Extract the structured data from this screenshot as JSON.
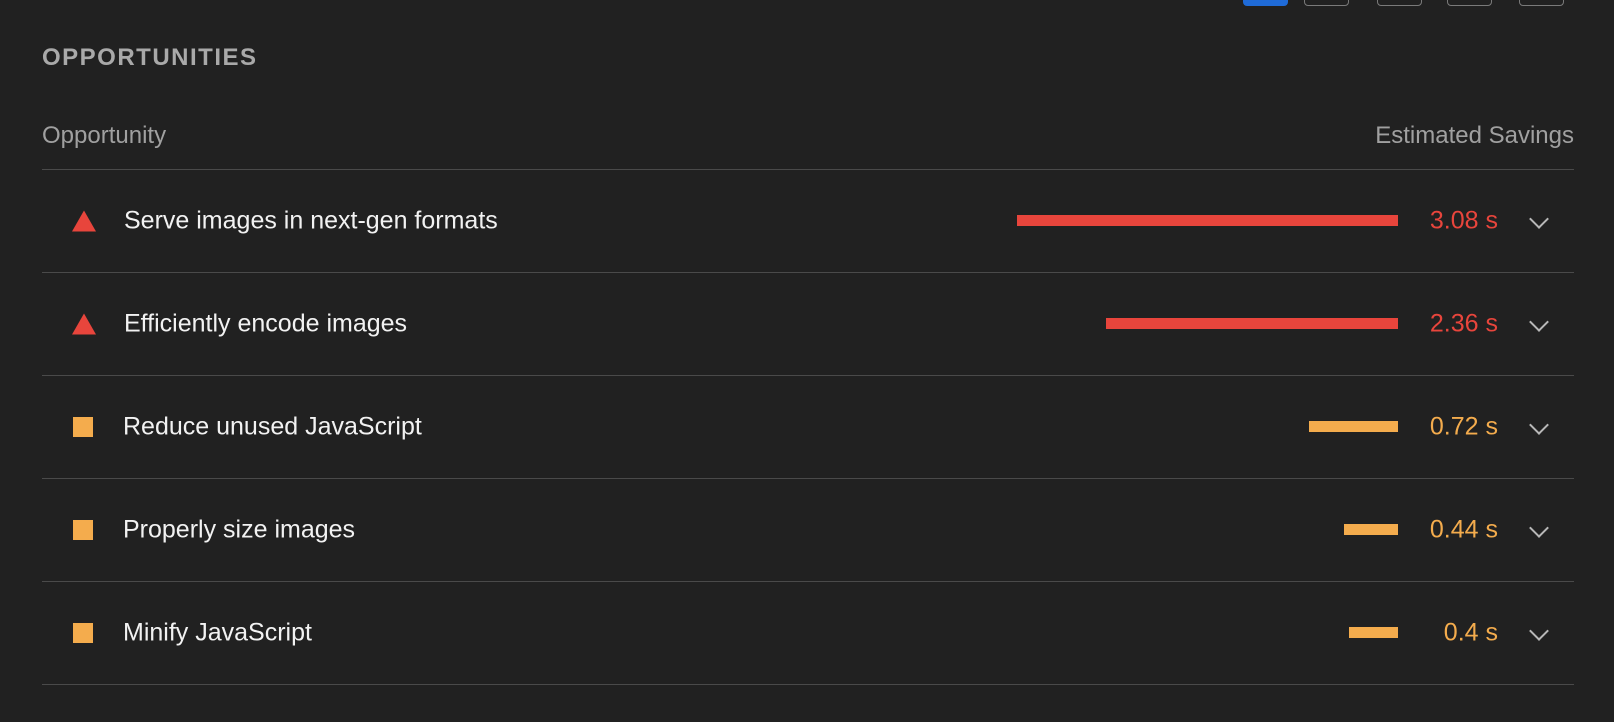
{
  "section": {
    "title": "OPPORTUNITIES"
  },
  "table": {
    "col_opportunity": "Opportunity",
    "col_savings": "Estimated Savings"
  },
  "top_filters": {
    "count": 5,
    "active_index": 0,
    "active_color": "#1f6bd8"
  },
  "colors": {
    "fail": "#e8453c",
    "average": "#f4ac4d",
    "background": "#212121"
  },
  "opportunities": [
    {
      "title": "Serve images in next-gen formats",
      "savings": "3.08 s",
      "savings_seconds": 3.08,
      "status": "fail",
      "icon": "triangle-fail-icon"
    },
    {
      "title": "Efficiently encode images",
      "savings": "2.36 s",
      "savings_seconds": 2.36,
      "status": "fail",
      "icon": "triangle-fail-icon"
    },
    {
      "title": "Reduce unused JavaScript",
      "savings": "0.72 s",
      "savings_seconds": 0.72,
      "status": "average",
      "icon": "square-average-icon"
    },
    {
      "title": "Properly size images",
      "savings": "0.44 s",
      "savings_seconds": 0.44,
      "status": "average",
      "icon": "square-average-icon"
    },
    {
      "title": "Minify JavaScript",
      "savings": "0.4 s",
      "savings_seconds": 0.4,
      "status": "average",
      "icon": "square-average-icon"
    }
  ]
}
